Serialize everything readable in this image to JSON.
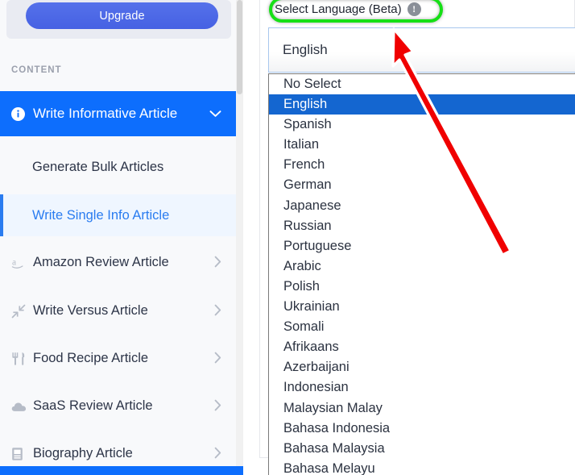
{
  "sidebar": {
    "upgrade_label": "Upgrade",
    "section_label": "CONTENT",
    "active_item": {
      "label": "Write Informative Article",
      "icon": "info-circle-icon",
      "chevron": "⌄"
    },
    "sub_items": [
      {
        "label": "Generate Bulk Articles",
        "active": false
      },
      {
        "label": "Write Single Info Article",
        "active": true
      }
    ],
    "items": [
      {
        "label": "Amazon Review Article",
        "icon": "amazon-a-icon",
        "glyph": "a",
        "chevron": "›"
      },
      {
        "label": "Write Versus Article",
        "icon": "compress-arrows-icon",
        "glyph": "⤢",
        "chevron": "›"
      },
      {
        "label": "Food Recipe Article",
        "icon": "utensils-icon",
        "glyph": "🍴",
        "chevron": "›"
      },
      {
        "label": "SaaS Review Article",
        "icon": "cloud-icon",
        "glyph": "☁",
        "chevron": "›"
      },
      {
        "label": "Biography Article",
        "icon": "book-icon",
        "glyph": "📕",
        "chevron": "›"
      }
    ]
  },
  "main": {
    "field_label": "Select Language (Beta)",
    "info_icon_glyph": "!",
    "selected_value": "English",
    "options": [
      "No Select",
      "English",
      "Spanish",
      "Italian",
      "French",
      "German",
      "Japanese",
      "Russian",
      "Portuguese",
      "Arabic",
      "Polish",
      "Ukrainian",
      "Somali",
      "Afrikaans",
      "Azerbaijani",
      "Indonesian",
      "Malaysian Malay",
      "Bahasa Indonesia",
      "Bahasa Malaysia",
      "Bahasa Melayu"
    ],
    "selected_index": 1
  },
  "annotations": {
    "highlight_color": "#16e016",
    "arrow_color": "#f00000",
    "accent_blue": "#0d6efd",
    "selection_blue": "#1466d0",
    "upgrade_blue": "#4661e3"
  }
}
